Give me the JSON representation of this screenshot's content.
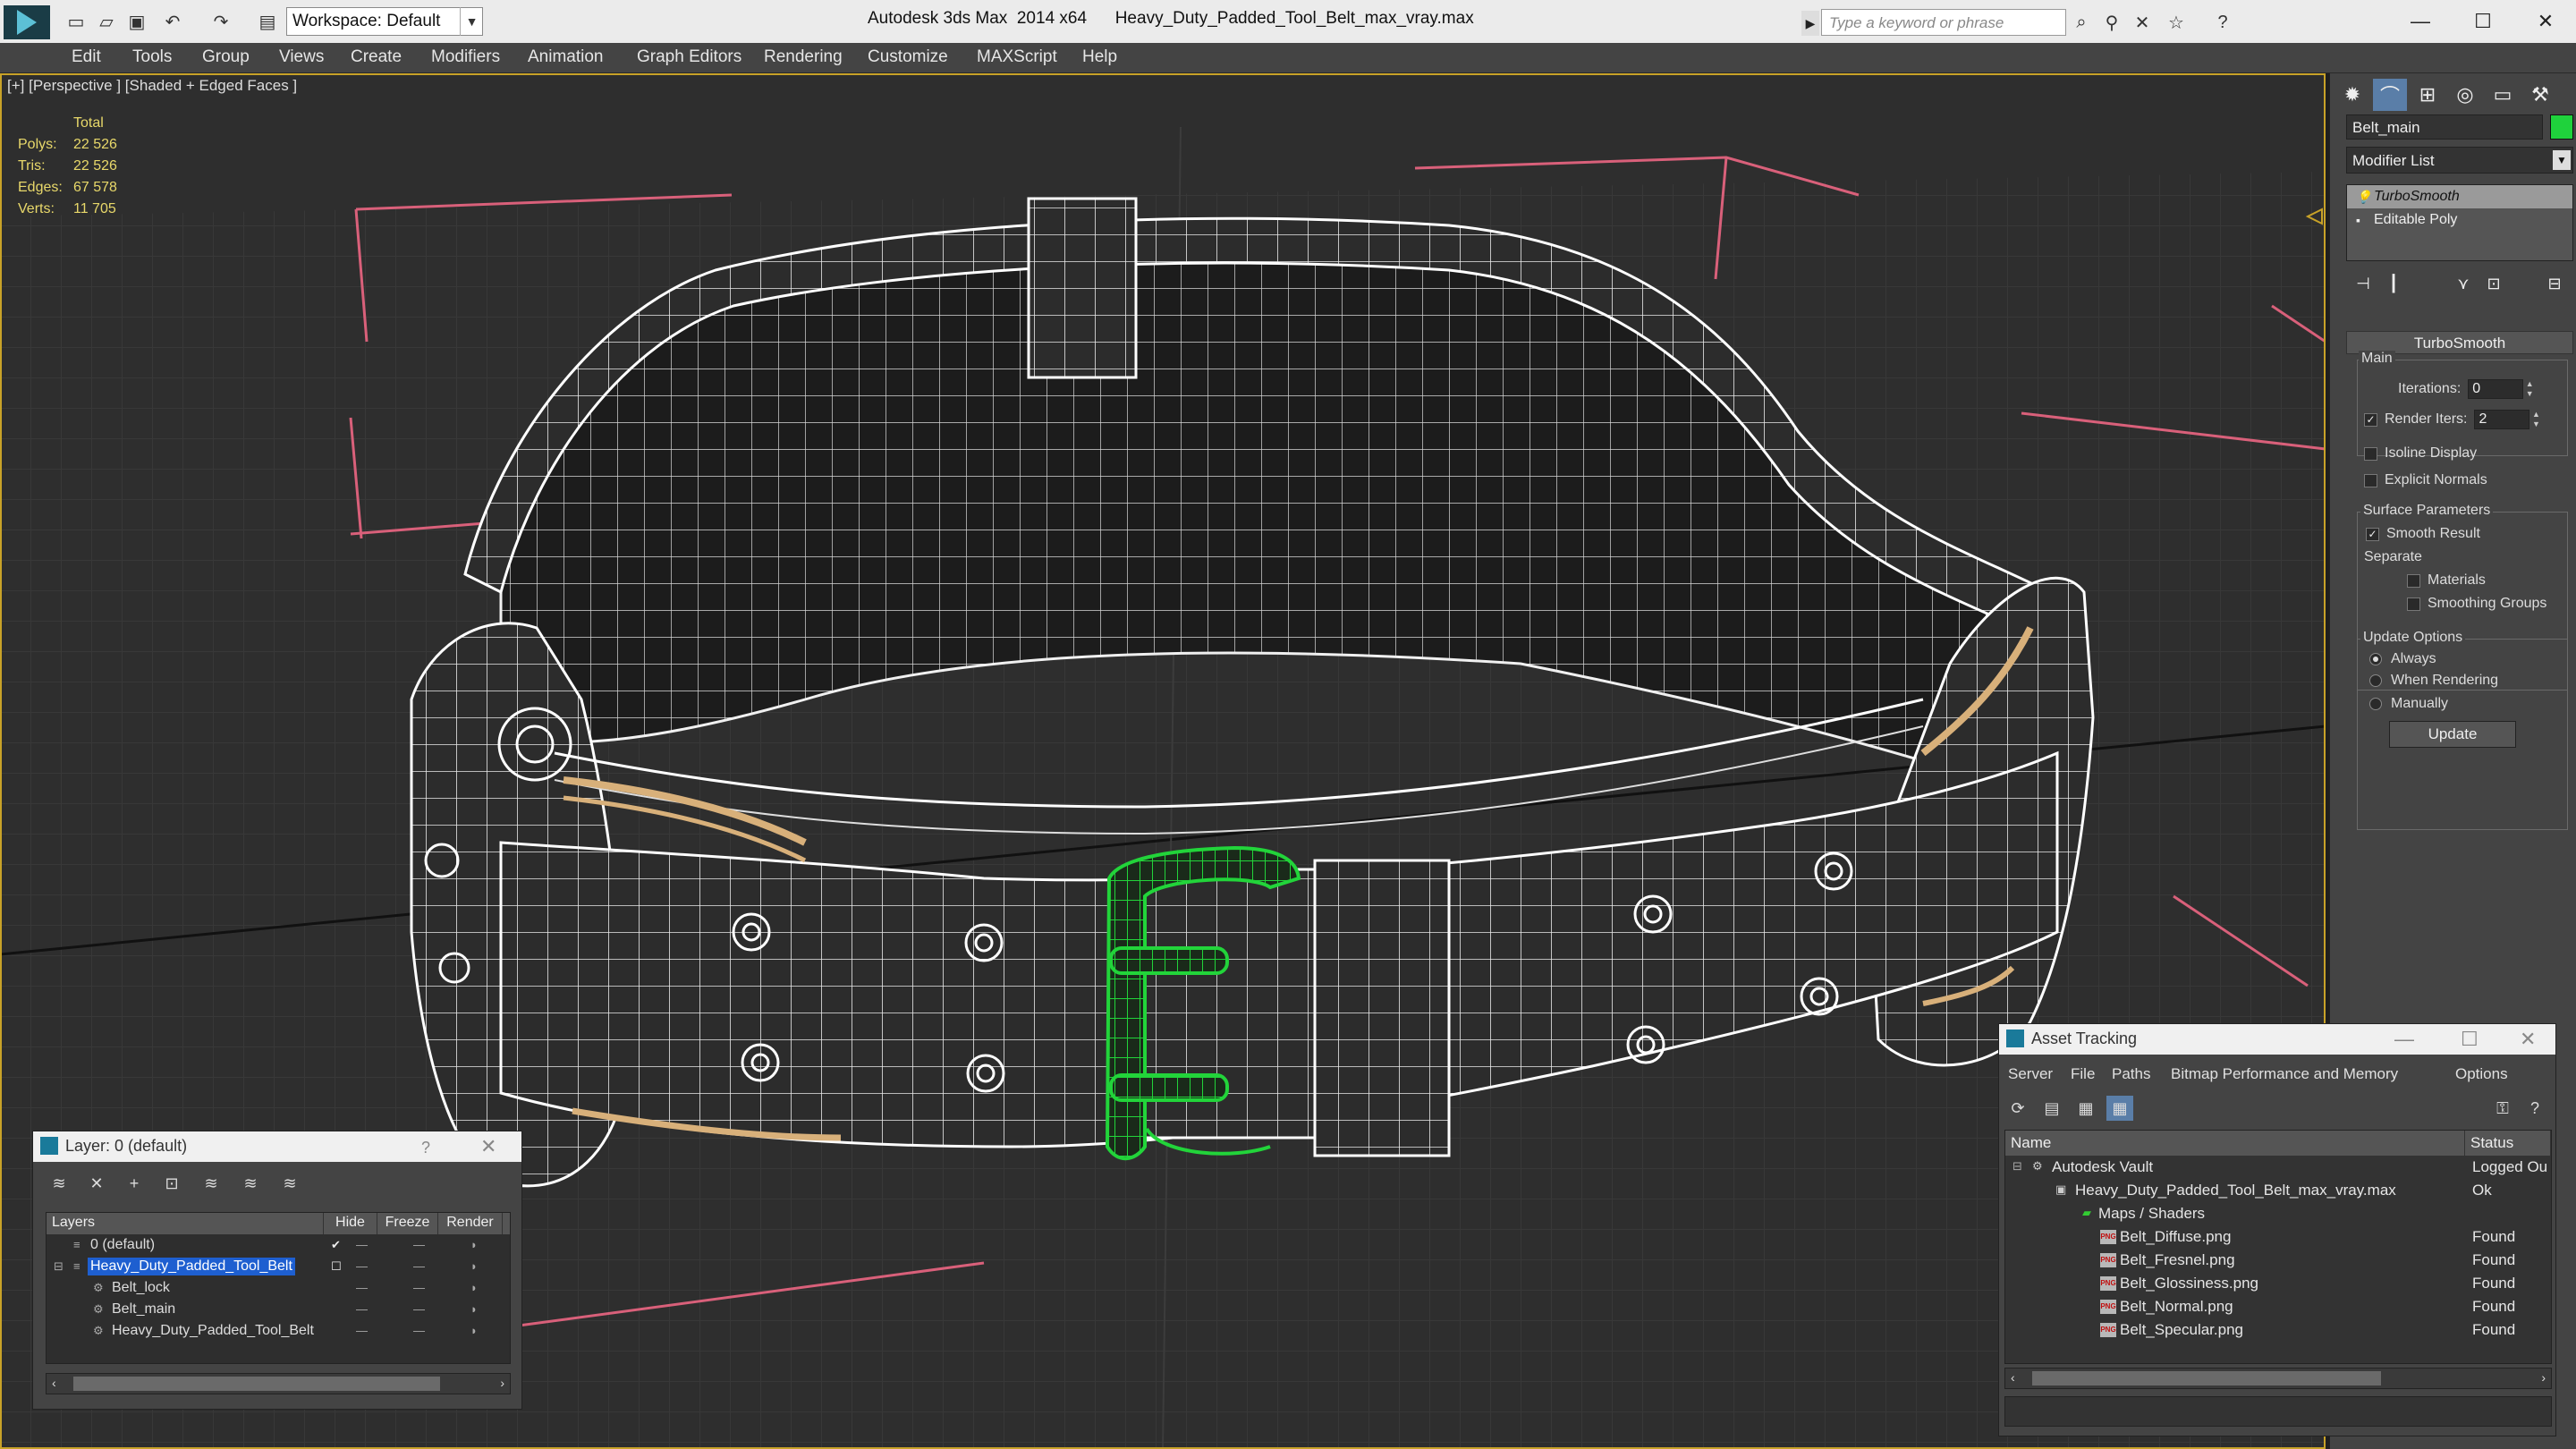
{
  "app": {
    "title": "Autodesk 3ds Max  2014 x64      Heavy_Duty_Padded_Tool_Belt_max_vray.max",
    "workspace": "Workspace: Default",
    "search_placeholder": "Type a keyword or phrase"
  },
  "menu": [
    "Edit",
    "Tools",
    "Group",
    "Views",
    "Create",
    "Modifiers",
    "Animation",
    "Graph Editors",
    "Rendering",
    "Customize",
    "MAXScript",
    "Help"
  ],
  "viewport": {
    "label": "[+] [Perspective ] [Shaded + Edged Faces ]",
    "stats_header": "Total",
    "stats": [
      {
        "k": "Polys:",
        "v": "22 526"
      },
      {
        "k": "Tris:",
        "v": "22 526"
      },
      {
        "k": "Edges:",
        "v": "67 578"
      },
      {
        "k": "Verts:",
        "v": "11 705"
      }
    ]
  },
  "command_panel": {
    "object_name": "Belt_main",
    "object_color": "#1fd23c",
    "modifier_list": "Modifier List",
    "stack": [
      "TurboSmooth",
      "Editable Poly"
    ],
    "rollout_title": "TurboSmooth",
    "main_group": "Main",
    "iterations_label": "Iterations:",
    "iterations_value": "0",
    "render_iters_label": "Render Iters:",
    "render_iters_value": "2",
    "render_iters_checked": true,
    "isoline_display": "Isoline Display",
    "explicit_normals": "Explicit Normals",
    "surface_params": "Surface Parameters",
    "smooth_result": "Smooth Result",
    "separate": "Separate",
    "materials": "Materials",
    "smoothing_groups": "Smoothing Groups",
    "update_options": "Update Options",
    "always": "Always",
    "when_rendering": "When Rendering",
    "manually": "Manually",
    "update_button": "Update"
  },
  "layer_window": {
    "title": "Layer: 0 (default)",
    "help": "?",
    "columns": [
      "Layers",
      "Hide",
      "Freeze",
      "Render"
    ],
    "rows": [
      {
        "name": "0 (default)",
        "indent": 1,
        "selected": false,
        "checked": true
      },
      {
        "name": "Heavy_Duty_Padded_Tool_Belt",
        "indent": 1,
        "selected": true,
        "checked": false
      },
      {
        "name": "Belt_lock",
        "indent": 2,
        "selected": false,
        "checked": false
      },
      {
        "name": "Belt_main",
        "indent": 2,
        "selected": false,
        "checked": false
      },
      {
        "name": "Heavy_Duty_Padded_Tool_Belt",
        "indent": 2,
        "selected": false,
        "checked": false
      }
    ]
  },
  "asset_window": {
    "title": "Asset Tracking",
    "menu": [
      "Server",
      "File",
      "Paths",
      "Bitmap Performance and Memory",
      "Options"
    ],
    "columns": [
      "Name",
      "Status"
    ],
    "rows": [
      {
        "name": "Autodesk Vault",
        "status": "Logged Ou",
        "indent": 0,
        "icon": "vault-icon"
      },
      {
        "name": "Heavy_Duty_Padded_Tool_Belt_max_vray.max",
        "status": "Ok",
        "indent": 1,
        "icon": "max-file-icon"
      },
      {
        "name": "Maps / Shaders",
        "status": "",
        "indent": 2,
        "icon": "folder-icon"
      },
      {
        "name": "Belt_Diffuse.png",
        "status": "Found",
        "indent": 3,
        "icon": "png-icon"
      },
      {
        "name": "Belt_Fresnel.png",
        "status": "Found",
        "indent": 3,
        "icon": "png-icon"
      },
      {
        "name": "Belt_Glossiness.png",
        "status": "Found",
        "indent": 3,
        "icon": "png-icon"
      },
      {
        "name": "Belt_Normal.png",
        "status": "Found",
        "indent": 3,
        "icon": "png-icon"
      },
      {
        "name": "Belt_Specular.png",
        "status": "Found",
        "indent": 3,
        "icon": "png-icon"
      }
    ]
  },
  "colors": {
    "viewport_bg": "#2e2e2e",
    "wire": "#f2f2f2",
    "selected_wire": "#22d43a",
    "stats_text": "#e8d86a",
    "selection_blue": "#1e5fd0",
    "active_border": "#c8a228",
    "gizmo_pink": "#d9607a",
    "leather_trim": "#d8b07a"
  }
}
